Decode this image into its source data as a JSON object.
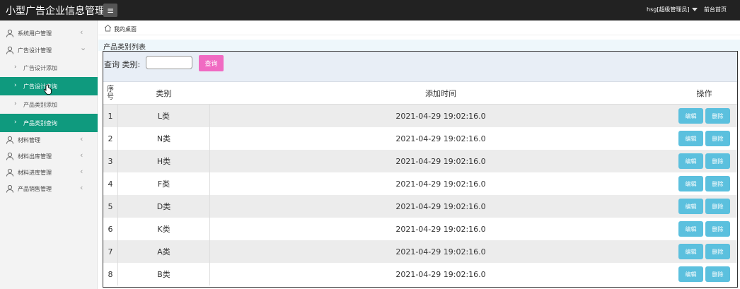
{
  "app": {
    "title": "小型广告企业信息管理系",
    "user_label": "hsg[超级管理员]",
    "home_link": "前台首页"
  },
  "sidebar": {
    "items": [
      {
        "label": "系统用户管理",
        "icon": "user-icon",
        "chevron": "‹"
      },
      {
        "label": "广告设计管理",
        "icon": "user-icon",
        "chevron": "⌄"
      },
      {
        "label": "广告设计添加",
        "arrow": "›"
      },
      {
        "label": "广告设计查询",
        "arrow": "›"
      },
      {
        "label": "产品类别添加",
        "arrow": "›"
      },
      {
        "label": "产品类别查询",
        "arrow": "›"
      },
      {
        "label": "材料管理",
        "icon": "user-icon",
        "chevron": "‹"
      },
      {
        "label": "材料出库管理",
        "icon": "user-icon",
        "chevron": "‹"
      },
      {
        "label": "材料进库管理",
        "icon": "user-icon",
        "chevron": "‹"
      },
      {
        "label": "产品销售管理",
        "icon": "user-icon",
        "chevron": "‹"
      }
    ]
  },
  "breadcrumb": {
    "text": "我的桌面",
    "icon": "home-icon"
  },
  "panel": {
    "title": "产品类别列表"
  },
  "search": {
    "label": "查询 类别:",
    "value": "",
    "placeholder": "",
    "button_label": "查询"
  },
  "table": {
    "headers": {
      "no": "序号",
      "type": "类别",
      "time": "添加时间",
      "op": "操作"
    },
    "edit_label": "编辑",
    "delete_label": "删除",
    "rows": [
      {
        "no": "1",
        "type": "L类",
        "time": "2021-04-29 19:02:16.0"
      },
      {
        "no": "2",
        "type": "N类",
        "time": "2021-04-29 19:02:16.0"
      },
      {
        "no": "3",
        "type": "H类",
        "time": "2021-04-29 19:02:16.0"
      },
      {
        "no": "4",
        "type": "F类",
        "time": "2021-04-29 19:02:16.0"
      },
      {
        "no": "5",
        "type": "D类",
        "time": "2021-04-29 19:02:16.0"
      },
      {
        "no": "6",
        "type": "K类",
        "time": "2021-04-29 19:02:16.0"
      },
      {
        "no": "7",
        "type": "A类",
        "time": "2021-04-29 19:02:16.0"
      },
      {
        "no": "8",
        "type": "B类",
        "time": "2021-04-29 19:02:16.0"
      }
    ]
  },
  "colors": {
    "topbar": "#222222",
    "active_menu": "#0f9a7e",
    "search_button": "#f06ac2",
    "action_button": "#5bc0de"
  }
}
